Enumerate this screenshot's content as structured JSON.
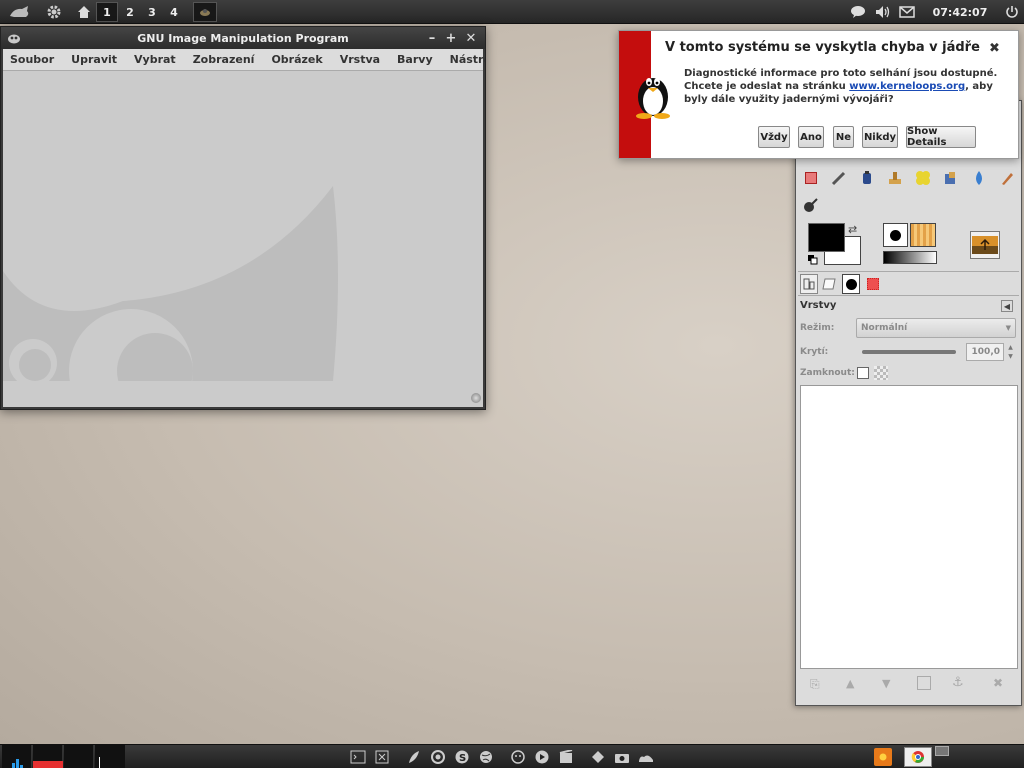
{
  "top_panel": {
    "workspaces": [
      "1",
      "2",
      "3",
      "4"
    ],
    "clock": "07:42:07",
    "icons": [
      "app-menu-icon",
      "settings-gear-icon",
      "home-icon",
      "workspace-thumbnail-icon",
      "chat-bubble-icon",
      "volume-icon",
      "mail-icon",
      "power-icon"
    ]
  },
  "gimp_window": {
    "title": "GNU Image Manipulation Program",
    "controls": {
      "minimize": "–",
      "maximize": "+",
      "close": "✕"
    },
    "menu": [
      "Soubor",
      "Upravit",
      "Vybrat",
      "Zobrazení",
      "Obrázek",
      "Vrstva",
      "Barvy",
      "Nástroje"
    ]
  },
  "notification": {
    "title": "V tomto systému se vyskytla chyba v jádře",
    "close": "✖",
    "line1": "Diagnostické informace pro toto selhání jsou dostupné.",
    "line2_pre": "Chcete je odeslat na stránku ",
    "link": "www.kerneloops.org",
    "line2_post": ", aby",
    "line3": "byly dále využity jadernými vývojáři?",
    "buttons": [
      "Vždy",
      "Ano",
      "Ne",
      "Nikdy",
      "Show Details"
    ]
  },
  "toolbox": {
    "tools_row1": [
      "rect-select-icon",
      "color-picker-icon",
      "ink-icon",
      "clone-stamp-icon",
      "heal-icon",
      "perspective-clone-icon",
      "blur-icon",
      "smudge-icon"
    ],
    "tools_row2": [
      "dodge-burn-icon"
    ],
    "tabs": [
      "layers-tab-icon",
      "channels-tab-icon",
      "paths-tab-icon",
      "undo-tab-icon"
    ],
    "layers": {
      "title": "Vrstvy",
      "mode_label": "Režim:",
      "mode_value": "Normální",
      "opacity_label": "Krytí:",
      "opacity_value": "100,0",
      "lock_label": "Zamknout:"
    },
    "colors": {
      "foreground": "#000000",
      "background": "#ffffff"
    }
  },
  "bottom_panel": {
    "icons": [
      "terminal-icon",
      "window-close-icon",
      "feather-icon",
      "chrome-icon",
      "skype-icon",
      "globe-icon",
      "face-icon",
      "play-icon",
      "film-icon",
      "network-icon",
      "camera-icon",
      "shoe-icon",
      "sun-icon",
      "chrome-window-icon",
      "window-icon"
    ]
  }
}
